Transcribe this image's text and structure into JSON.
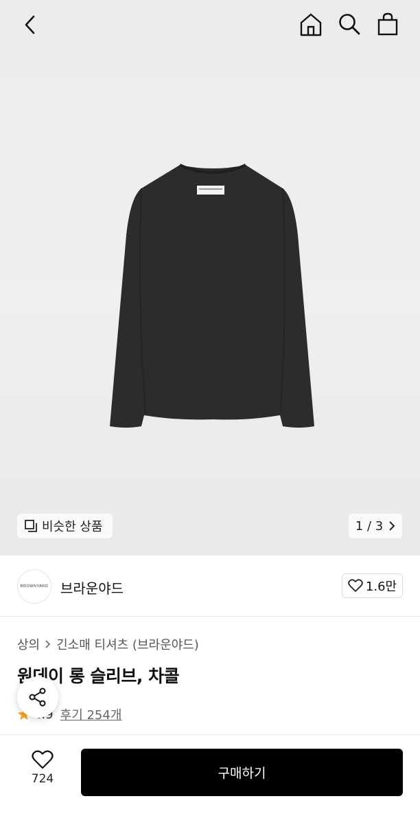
{
  "header": {
    "back_icon": "chevron-left-icon",
    "home_icon": "home-icon",
    "search_icon": "search-icon",
    "cart_icon": "shopping-bag-icon"
  },
  "gallery": {
    "similar_label": "비슷한 상품",
    "page_indicator": "1 / 3"
  },
  "brand": {
    "logo_text": "BROWNYARD",
    "name": "브라운야드",
    "likes": "1.6만"
  },
  "breadcrumb": {
    "category": "상의",
    "subcategory": "긴소매 티셔츠 (브라운야드)"
  },
  "product": {
    "title": "원데이 롱 슬리브, 차콜",
    "rating": "4.9",
    "reviews_label": "후기 254개"
  },
  "bottom_bar": {
    "wish_count": "724",
    "buy_label": "구매하기"
  },
  "colors": {
    "accent_star": "#f5a623",
    "buy_button": "#000000"
  }
}
